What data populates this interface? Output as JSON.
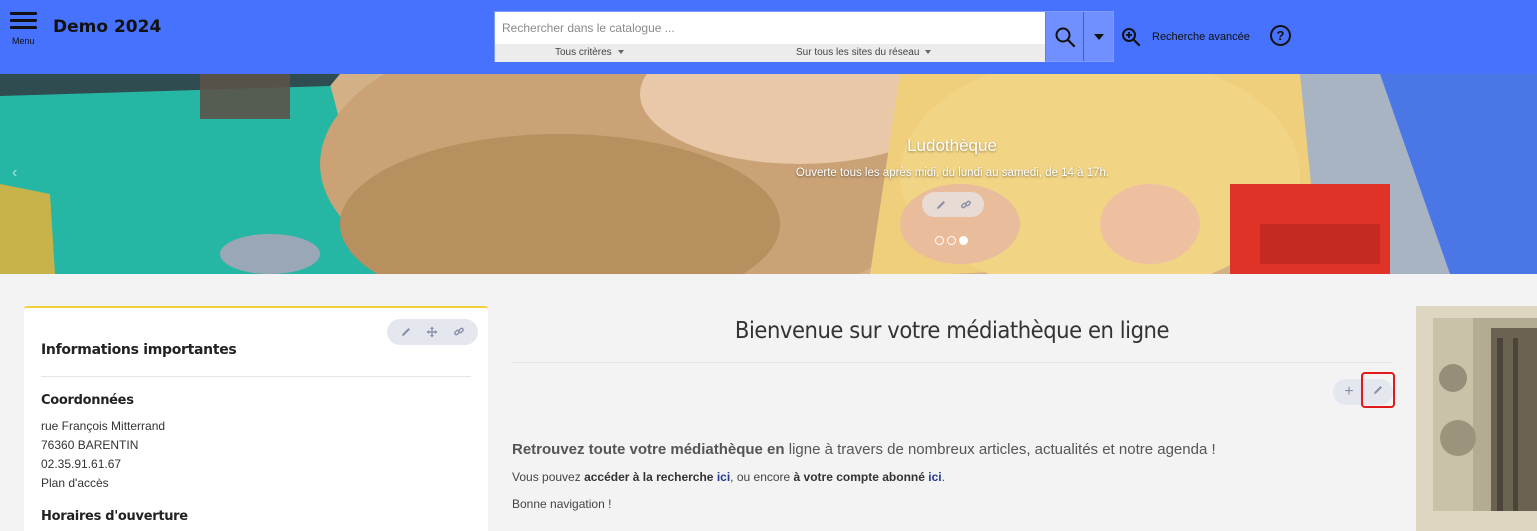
{
  "header": {
    "menu_label": "Menu",
    "site_title": "Demo 2024",
    "search": {
      "placeholder": "Rechercher dans le catalogue ...",
      "criteria": "Tous critères",
      "scope": "Sur tous les sites du réseau"
    },
    "advanced_search": "Recherche avancée",
    "help": "?"
  },
  "banner": {
    "title": "Ludothèque",
    "subtitle": "Ouverte tous les après midi, du lundi au samedi, de 14 à 17h.",
    "dots": 3,
    "active_dot": 3
  },
  "left_panel": {
    "title": "Informations importantes",
    "contact_heading": "Coordonnées",
    "address_line1": "rue François Mitterrand",
    "address_line2": "76360 BARENTIN",
    "phone": "02.35.91.61.67",
    "map_link": "Plan d'accès",
    "hours_heading": "Horaires d'ouverture"
  },
  "main": {
    "title": "Bienvenue sur votre médiathèque en ligne",
    "add": "+",
    "lead_bold": "Retrouvez toute votre médiathèque en",
    "lead_rest": " ligne à travers de nombreux articles, actualités et notre agenda !",
    "p1_a": "Vous pouvez ",
    "p1_b": "accéder à la recherche",
    "p1_link1": "ici",
    "p1_c": ", ou encore ",
    "p1_d": "à votre compte abonné",
    "p1_link2": "ici",
    "p1_e": ".",
    "p2": "Bonne navigation !"
  },
  "colors": {
    "header_bg": "#4672fe",
    "panel_accent": "#f2cf3b",
    "link": "#233a8e",
    "highlight": "#e0191c"
  }
}
